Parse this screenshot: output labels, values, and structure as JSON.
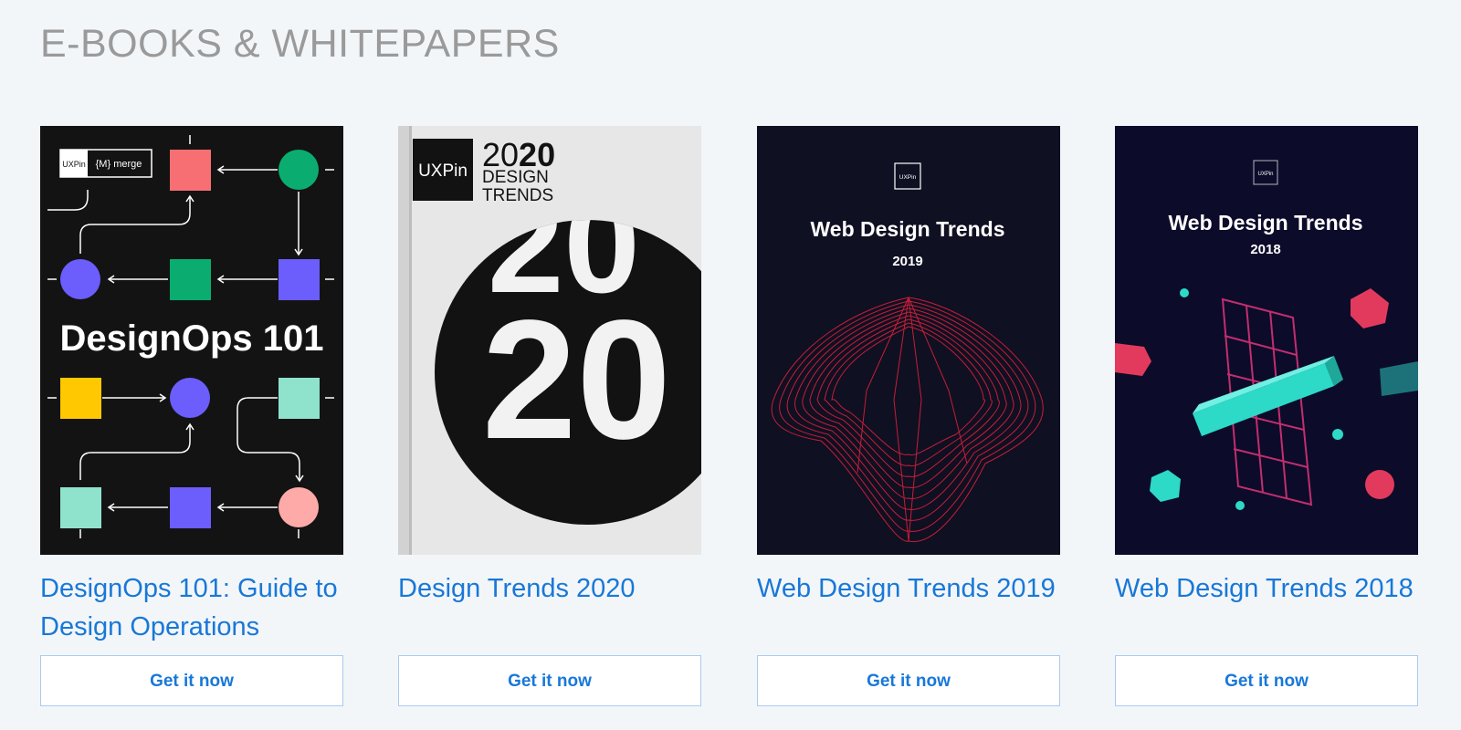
{
  "section": {
    "title": "E-BOOKS & WHITEPAPERS"
  },
  "books": [
    {
      "title": "DesignOps 101: Guide to Design Operations",
      "button": "Get it now",
      "cover": {
        "badge_uxpin": "UXPin",
        "badge_merge": "{M} merge",
        "headline": "DesignOps 101",
        "colors": {
          "bg": "#131313",
          "coral": "#f76f73",
          "green": "#0aad6f",
          "violet": "#6b5efc",
          "yellow": "#ffc800",
          "mint": "#8fe3cc",
          "pink": "#fdaaa8"
        }
      }
    },
    {
      "title": "Design Trends 2020",
      "button": "Get it now",
      "cover": {
        "badge": "UXPin",
        "year_light": "20",
        "year_bold": "20",
        "line1": "DESIGN",
        "line2": "TRENDS",
        "circle_top": "20",
        "circle_main": "20",
        "colors": {
          "bg": "#e7e7e7",
          "ink": "#121212",
          "paper": "#f2f2f2"
        }
      }
    },
    {
      "title": "Web Design Trends 2019",
      "button": "Get it now",
      "cover": {
        "badge": "UXPin",
        "headline": "Web Design Trends",
        "year": "2019",
        "colors": {
          "bg": "#0f1022",
          "accent": "#d9203a"
        }
      }
    },
    {
      "title": "Web Design Trends 2018",
      "button": "Get it now",
      "cover": {
        "badge": "UXPin",
        "headline": "Web Design Trends",
        "year": "2018",
        "colors": {
          "bg": "#0c0b2a",
          "teal": "#2dd9c7",
          "pink": "#e23a5c",
          "grid": "#c22e6e"
        }
      }
    }
  ]
}
